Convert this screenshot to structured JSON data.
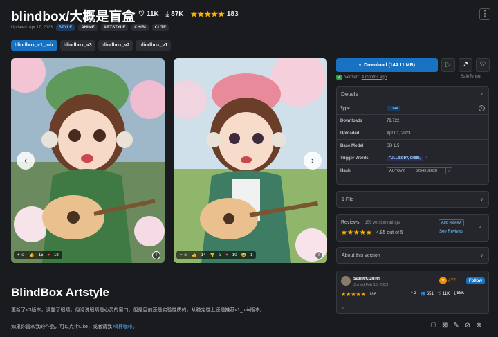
{
  "header": {
    "title": "blindbox/大概是盲盒",
    "likes": "11K",
    "downloads": "87K",
    "rating_count": "183",
    "stars": "★★★★★",
    "menu": "⋮"
  },
  "meta": {
    "updated": "Updated: Apr 17, 2023",
    "tags": [
      "STYLE",
      "ANIME",
      "ARTSTYLE",
      "CHIBI",
      "CUTE"
    ]
  },
  "versions": [
    "blindbox_v1_mix",
    "blindbox_v3",
    "blindbox_v2",
    "blindbox_v1"
  ],
  "gallery": {
    "left": {
      "react_add": "+ ☺",
      "likes": "15",
      "hearts": "18"
    },
    "right": {
      "react_add": "+ ☺",
      "likes": "14",
      "dislike": "3",
      "hearts": "10",
      "laugh": "1"
    },
    "prev": "‹",
    "next": "›",
    "info": "i"
  },
  "download": {
    "label": "Download (144.11 MB)",
    "verified": "Verified:",
    "verified_time": "4 months ago",
    "safe": "SafeTensor"
  },
  "details": {
    "title": "Details",
    "rows": [
      {
        "label": "Type",
        "value": "LORA"
      },
      {
        "label": "Downloads",
        "value": "79,722"
      },
      {
        "label": "Uploaded",
        "value": "Apr 01, 2023"
      },
      {
        "label": "Base Model",
        "value": "SD 1.5"
      },
      {
        "label": "Trigger Words",
        "value": "FULL BODY, CHIBI,"
      },
      {
        "label": "Hash",
        "value": "AUTOV2",
        "hash": "525491E628"
      }
    ]
  },
  "files": {
    "label": "1 File"
  },
  "reviews": {
    "title": "Reviews",
    "count": "159 version ratings",
    "stars": "★★★★★",
    "score": "4.95 out of 5",
    "add": "Add Review",
    "see": "See Reviews"
  },
  "about": {
    "label": "About this version"
  },
  "creator": {
    "name": "samecorner",
    "joined": "Joined Feb 15, 2023",
    "rank": "#77",
    "follow": "Follow",
    "stars": "★★★★★",
    "rating": "186",
    "uploads": "2",
    "followers": "651",
    "likes": "11K",
    "downloads": "88K"
  },
  "content": {
    "heading": "BlindBox Artstyle",
    "p1": "更新了V3版本，调整了眼睛，俗话说眼睛是心灵的窗口。但是目前还是实验性质的，从稳定性上还是推荐v1_mix版本。",
    "p2": "如果你喜欢我的作品，可以点个Like，或者请我",
    "p2_link": "喝杯咖啡",
    "p2_end": "。"
  },
  "colors": {
    "accent": "#1971c2",
    "bg": "#1a1b1e",
    "panel": "#25262b",
    "star": "#fab005"
  }
}
